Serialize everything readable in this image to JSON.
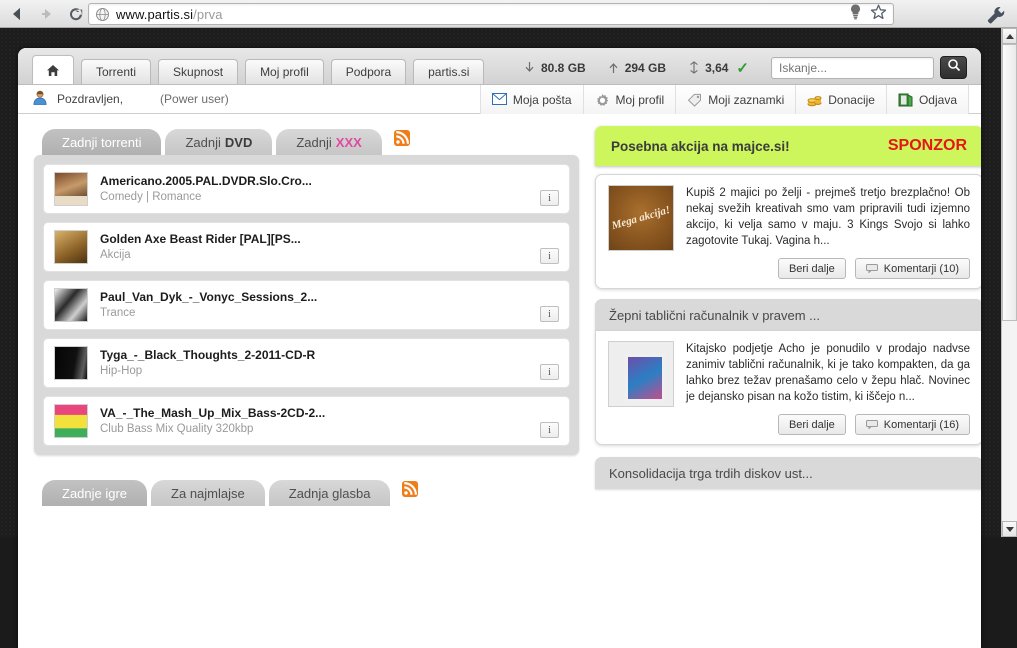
{
  "browser": {
    "url_main": "www.partis.si",
    "url_path": "/prva",
    "back_icon": "back-arrow-icon",
    "forward_icon": "forward-arrow-icon",
    "reload_icon": "reload-icon",
    "globe_icon": "globe-icon",
    "bulb_icon": "lightbulb-icon",
    "star_icon": "star-icon",
    "wrench_icon": "wrench-icon"
  },
  "topnav": {
    "home_label": "Domov",
    "tabs": [
      {
        "label": "Torrenti"
      },
      {
        "label": "Skupnost"
      },
      {
        "label": "Moj profil"
      },
      {
        "label": "Podpora"
      },
      {
        "label": "partis.si"
      }
    ],
    "stats": [
      {
        "icon": "download-arrow-icon",
        "value": "80.8 GB"
      },
      {
        "icon": "upload-arrow-icon",
        "value": "294 GB"
      },
      {
        "icon": "ratio-icon",
        "value": "3,64"
      }
    ],
    "ratio_ok": "✓",
    "search_placeholder": "Iskanje...",
    "search_value": "",
    "search_button_icon": "search-icon"
  },
  "userbar": {
    "avatar_icon": "user-avatar-icon",
    "greeting": "Pozdravljen,",
    "role": "(Power user)",
    "menu": [
      {
        "label": "Moja pošta",
        "icon": "envelope-icon"
      },
      {
        "label": "Moj profil",
        "icon": "gear-icon"
      },
      {
        "label": "Moji zaznamki",
        "icon": "tag-icon"
      },
      {
        "label": "Donacije",
        "icon": "coins-icon"
      },
      {
        "label": "Odjava",
        "icon": "logout-icon"
      }
    ]
  },
  "left": {
    "tabs_top": [
      {
        "label": "Zadnji torrenti",
        "active": true
      },
      {
        "label": "Zadnji ",
        "bold": "DVD",
        "active": false
      },
      {
        "label": "Zadnji ",
        "pink": "XXX",
        "active": false
      }
    ],
    "rss_icon": "rss-icon",
    "torrents": [
      {
        "title": "Americano.2005.PAL.DVDR.Slo.Cro...",
        "category": "Comedy | Romance",
        "thumb": "th-americano",
        "info": "i"
      },
      {
        "title": "Golden Axe Beast Rider [PAL][PS...",
        "category": "Akcija",
        "thumb": "th-golden",
        "info": "i"
      },
      {
        "title": "Paul_Van_Dyk_-_Vonyc_Sessions_2...",
        "category": "Trance",
        "thumb": "th-paul",
        "info": "i"
      },
      {
        "title": "Tyga_-_Black_Thoughts_2-2011-CD-R",
        "category": "Hip-Hop",
        "thumb": "th-tyga",
        "info": "i"
      },
      {
        "title": "VA_-_The_Mash_Up_Mix_Bass-2CD-2...",
        "category": "Club Bass Mix Quality 320kbp",
        "thumb": "th-va",
        "info": "i"
      }
    ],
    "tabs_bottom": [
      {
        "label": "Zadnje igre",
        "active": true
      },
      {
        "label": "Za najmlajse",
        "active": false
      },
      {
        "label": "Zadnja glasba",
        "active": false
      }
    ]
  },
  "right": {
    "sponsor": {
      "title": "Posebna akcija na majce.si!",
      "tag": "SPONZOR",
      "badge_text": "Mega akcija!",
      "body": "Kupiš 2 majici po želji - prejmeš tretjo brezplačno! Ob nekaj svežih kreativah smo vam pripravili tudi izjemno akcijo, ki velja samo v maju. 3 Kings Svojo si lahko zagotovite Tukaj. Vagina h...",
      "read_more": "Beri dalje",
      "comments": "Komentarji (10)"
    },
    "articles": [
      {
        "title": "Žepni tablični računalnik v pravem ...",
        "body": "Kitajsko podjetje Acho je ponudilo v prodajo nadvse zanimiv tablični računalnik, ki je tako kompakten, da ga lahko brez težav prenašamo celo v žepu hlač. Novinec je dejansko pisan na kožo tistim, ki iščejo n...",
        "read_more": "Beri dalje",
        "comments": "Komentarji (16)",
        "thumb": "th-tablet"
      },
      {
        "title": "Konsolidacija trga trdih diskov ust...",
        "body": "",
        "read_more": "",
        "comments": "",
        "thumb": ""
      }
    ]
  },
  "colors": {
    "sponsor_green": "#cdf55c",
    "sponsor_red": "#e61616",
    "rss_orange": "#ef7d1a",
    "xxx_pink": "#e04aa0",
    "ratio_green": "#2f9e2f"
  }
}
